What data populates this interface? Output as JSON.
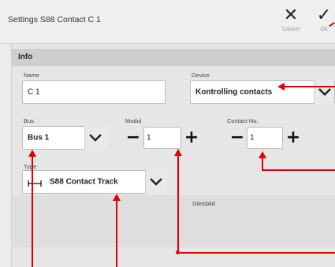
{
  "header": {
    "title": "Settings S88 Contact C 1",
    "cancel_label": "Cancel",
    "ok_label": "Ok",
    "cancel_glyph": "✕",
    "ok_glyph": "✓"
  },
  "section": {
    "title": "Info"
  },
  "form": {
    "name": {
      "label": "Name",
      "value": "C 1"
    },
    "device": {
      "label": "Device",
      "value": "Kontrolling contacts"
    },
    "bus": {
      "label": "Bus",
      "value": "Bus 1"
    },
    "modul": {
      "label": "Modul",
      "value": "1",
      "minus": "−",
      "plus": "+"
    },
    "contact": {
      "label": "Contact No.",
      "value": "1",
      "minus": "−",
      "plus": "+"
    },
    "type": {
      "label": "Type",
      "value": "S88 Contact Track",
      "icon": "track-icon"
    },
    "glossary": {
      "label": "Gleisbild"
    }
  },
  "colors": {
    "annotation": "#e00000",
    "header_bg": "#efefef",
    "section_bar": "#cfcfcf"
  }
}
